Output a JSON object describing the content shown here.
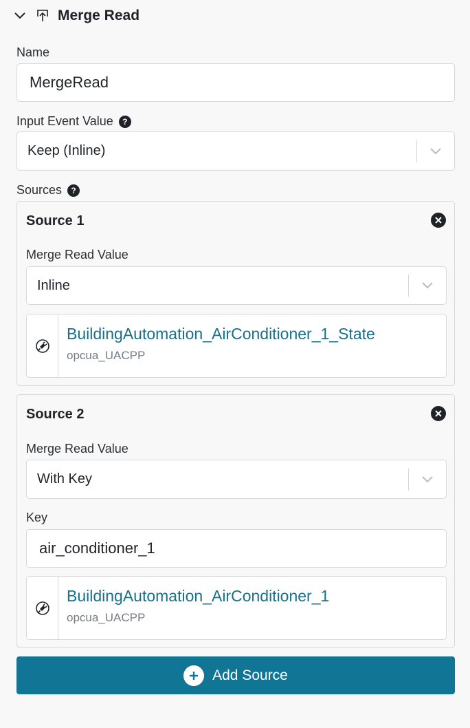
{
  "header": {
    "title": "Merge Read",
    "collapse_icon": "chevron-down-icon",
    "node_icon": "merge-read-icon"
  },
  "name_field": {
    "label": "Name",
    "value": "MergeRead"
  },
  "input_event": {
    "label": "Input Event Value",
    "value": "Keep (Inline)"
  },
  "sources": {
    "label": "Sources",
    "items": [
      {
        "title": "Source 1",
        "merge_label": "Merge Read Value",
        "merge_value": "Inline",
        "ref_name": "BuildingAutomation_AirConditioner_1_State",
        "ref_connection": "opcua_UACPP"
      },
      {
        "title": "Source 2",
        "merge_label": "Merge Read Value",
        "merge_value": "With Key",
        "key_label": "Key",
        "key_value": "air_conditioner_1",
        "ref_name": "BuildingAutomation_AirConditioner_1",
        "ref_connection": "opcua_UACPP"
      }
    ]
  },
  "add_button": {
    "label": "Add Source"
  },
  "colors": {
    "accent": "#117596",
    "link": "#167189",
    "border": "#d6d9dc",
    "background": "#f7f8f7"
  }
}
